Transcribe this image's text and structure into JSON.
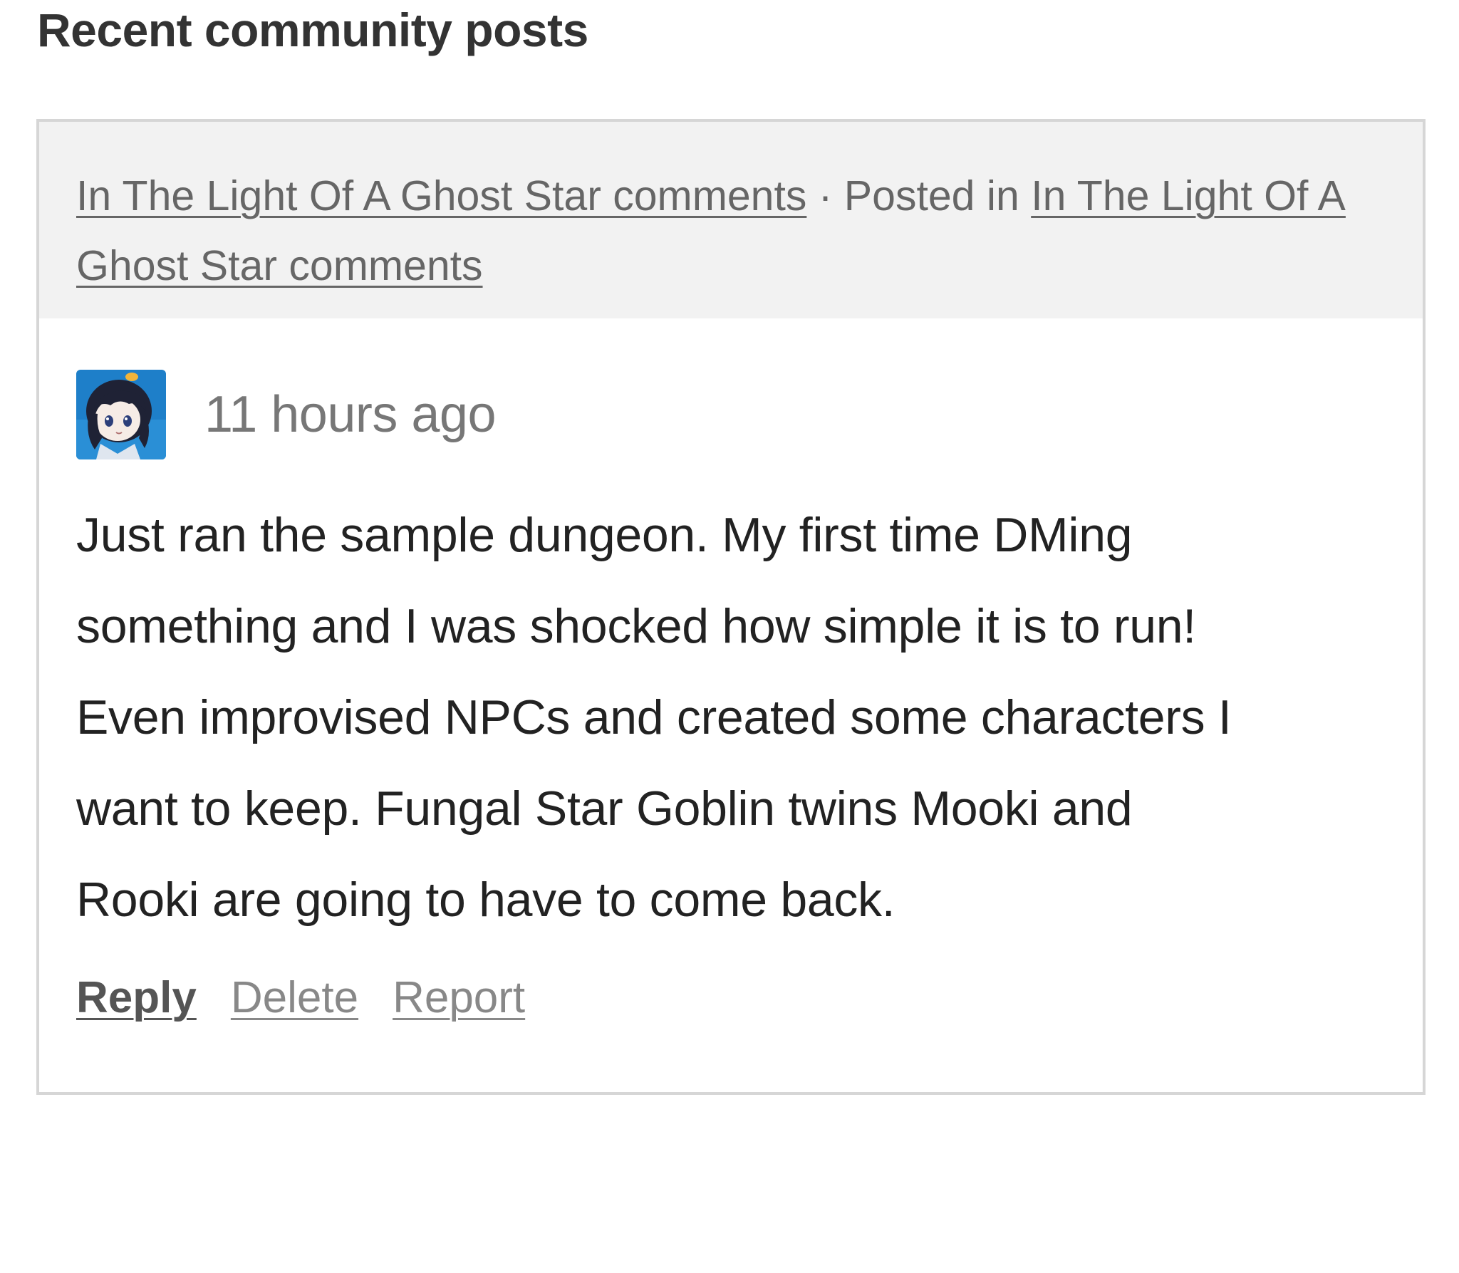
{
  "section": {
    "title": "Recent community posts"
  },
  "post": {
    "topic_link": "In The Light Of A Ghost Star comments",
    "separator": " · Posted in ",
    "board_link": "In The Light Of A Ghost Star comments",
    "avatar_icon": "user-avatar-anime-girl",
    "timestamp": "11 hours ago",
    "body": "Just ran the sample dungeon. My first time DMing\nsomething and I was shocked how simple it is to run!\nEven improvised NPCs and created some characters I\nwant to keep. Fungal Star Goblin twins Mooki and\nRooki are going to have to come back.",
    "actions": {
      "reply": "Reply",
      "delete": "Delete",
      "report": "Report"
    }
  },
  "colors": {
    "header_bg": "#f2f2f2",
    "border": "#d6d6d6",
    "link": "#666666",
    "muted_action": "#888888",
    "text": "#222222"
  }
}
